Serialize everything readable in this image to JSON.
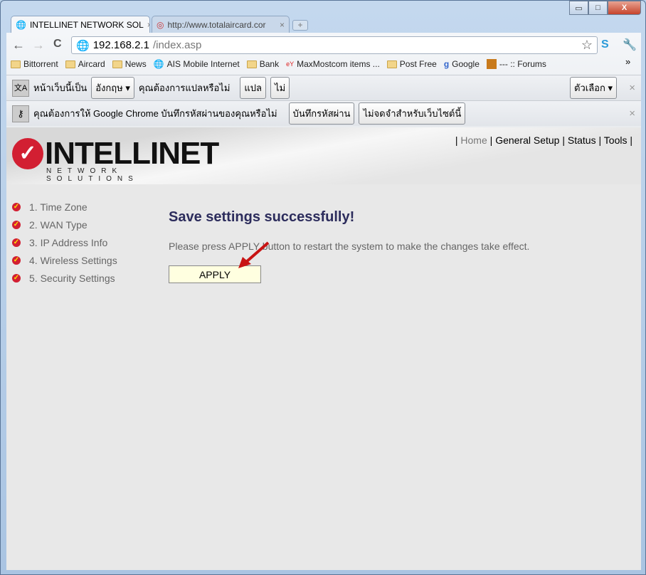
{
  "window": {
    "min": "▭",
    "max": "□",
    "close": "X"
  },
  "tabs": [
    {
      "label": "INTELLINET NETWORK SOL",
      "close": "×"
    },
    {
      "label": "http://www.totalaircard.cor",
      "close": "×"
    }
  ],
  "new_tab": "+",
  "nav": {
    "back": "←",
    "forward": "→",
    "reload": "C"
  },
  "omnibox": {
    "host": "192.168.2.1",
    "path": "/index.asp"
  },
  "bookmarks": [
    "Bittorrent",
    "Aircard",
    "News",
    "AIS Mobile Internet",
    "Bank",
    "MaxMostcom items ...",
    "Post Free",
    "Google",
    "--- :: Forums"
  ],
  "bookmarks_more": "»",
  "translate_bar": {
    "text1": "หน้าเว็บนี้เป็น",
    "language": "อังกฤษ",
    "text2": "คุณต้องการแปลหรือไม่",
    "translate": "แปล",
    "no": "ไม่",
    "options": "ตัวเลือก",
    "close": "×"
  },
  "password_bar": {
    "text": "คุณต้องการให้ Google Chrome บันทึกรหัสผ่านของคุณหรือไม่",
    "save": "บันทึกรหัสผ่าน",
    "never": "ไม่จดจำสำหรับเว็บไซต์นี้",
    "close": "×"
  },
  "logo": {
    "brand": "INTELLINET",
    "tagline": "NETWORK SOLUTIONS"
  },
  "topnav": {
    "home": "Home",
    "general": "General Setup",
    "status": "Status",
    "tools": "Tools"
  },
  "sidebar": [
    "1. Time Zone",
    "2. WAN Type",
    "3. IP Address Info",
    "4. Wireless Settings",
    "5. Security Settings"
  ],
  "main": {
    "title": "Save settings successfully!",
    "message": "Please press APPLY button to restart the system to make the changes take effect.",
    "apply": "APPLY"
  },
  "colors": {
    "brand_red": "#d21f32",
    "title": "#2c2c5c",
    "apply_bg": "#ffffe0"
  }
}
